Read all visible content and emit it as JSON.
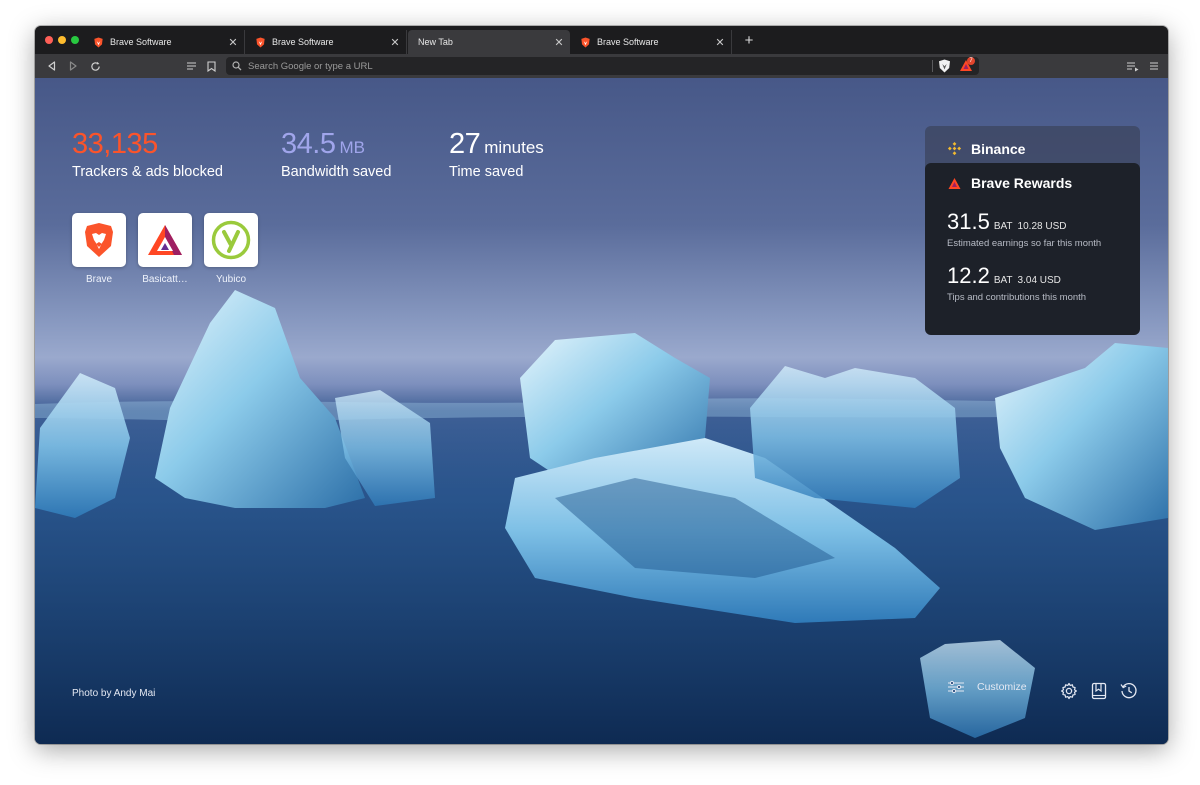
{
  "tabs": [
    {
      "label": "Brave Software",
      "active": false
    },
    {
      "label": "Brave Software",
      "active": false
    },
    {
      "label": "New Tab",
      "active": true
    },
    {
      "label": "Brave Software",
      "active": false
    }
  ],
  "toolbar": {
    "url_placeholder": "Search Google or type a URL",
    "rewards_badge": "7"
  },
  "stats": {
    "trackers": {
      "value": "33,135",
      "label": "Trackers & ads blocked",
      "color": "#fb542b"
    },
    "bandwidth": {
      "value": "34.5",
      "unit": "MB",
      "label": "Bandwidth saved",
      "color": "#a0a5eb"
    },
    "time": {
      "value": "27",
      "unit": "minutes",
      "label": "Time saved"
    }
  },
  "top_sites": [
    {
      "label": "Brave",
      "icon": "brave-lion-icon"
    },
    {
      "label": "Basicatt…",
      "icon": "bat-triangle-icon"
    },
    {
      "label": "Yubico",
      "icon": "yubico-icon"
    }
  ],
  "widgets": {
    "binance": {
      "title": "Binance"
    },
    "rewards": {
      "title": "Brave Rewards",
      "earnings": {
        "bat": "31.5",
        "bat_unit": "BAT",
        "usd": "10.28 USD",
        "desc": "Estimated earnings so far this month"
      },
      "tips": {
        "bat": "12.2",
        "bat_unit": "BAT",
        "usd": "3.04 USD",
        "desc": "Tips and contributions this month"
      }
    }
  },
  "footer": {
    "photo_credit": "Photo by Andy Mai",
    "customize_label": "Customize"
  }
}
